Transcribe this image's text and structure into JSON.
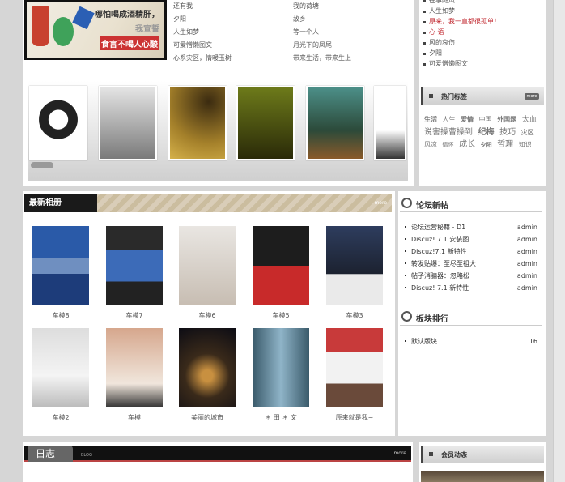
{
  "banner": {
    "line1": "哪怕喝成酒精肝，",
    "line2": "我宣誓",
    "line3": "食言不喝人心酸"
  },
  "center_links": {
    "left": [
      "还有我",
      "夕阳",
      "人生如梦",
      "可爱憎懒图文",
      "心系灾区，情暖玉树"
    ],
    "right": [
      "我的荷塘",
      "故乡",
      "等一个人",
      "月光下的凤尾",
      "带来生活，带来生上"
    ]
  },
  "right_list": [
    {
      "text": "往事随风",
      "red": false
    },
    {
      "text": "人生如梦",
      "red": false
    },
    {
      "text": "原来，我一直都很孤单！",
      "red": true
    },
    {
      "text": "心 语",
      "red": true
    },
    {
      "text": "风的哀伤",
      "red": false
    },
    {
      "text": "夕阳",
      "red": false
    },
    {
      "text": "可爱憎懒图文",
      "red": false
    }
  ],
  "hot_tags": {
    "title": "热门标签",
    "more": "more",
    "tags": [
      "生活",
      "人生",
      "爱情",
      "中国",
      "外国题",
      "太血",
      "说害操曹操到",
      "纪梅",
      "技巧",
      "灾区",
      "风凉",
      "情怀",
      "成长",
      "夕阳",
      "哲理",
      "知识"
    ]
  },
  "album": {
    "title": "最新相册",
    "more": "more",
    "row1": [
      "车模8",
      "车模7",
      "车模6",
      "车模5",
      "车模3"
    ],
    "row2": [
      "车模2",
      "车模",
      "美丽的城市",
      "＊ 田 ＊ 文",
      "原来就是我~"
    ]
  },
  "forum": {
    "title": "论坛新帖",
    "posts": [
      {
        "subject": "论坛运营秘籍 - D1",
        "author": "admin"
      },
      {
        "subject": "Discuz! 7.1 安装图",
        "author": "admin"
      },
      {
        "subject": "Discuz!7.1 新特性",
        "author": "admin"
      },
      {
        "subject": "转发贴爆：至尽至祖大",
        "author": "admin"
      },
      {
        "subject": "帖子消骗器：忽略松",
        "author": "admin"
      },
      {
        "subject": "Discuz! 7.1 新特性",
        "author": "admin"
      }
    ]
  },
  "board_rank": {
    "title": "板块排行",
    "rows": [
      {
        "name": "默认版块",
        "count": "16"
      }
    ]
  },
  "blog": {
    "title": "日志",
    "sub": "BLOG",
    "more": "more"
  },
  "member": {
    "title": "会员动态"
  }
}
